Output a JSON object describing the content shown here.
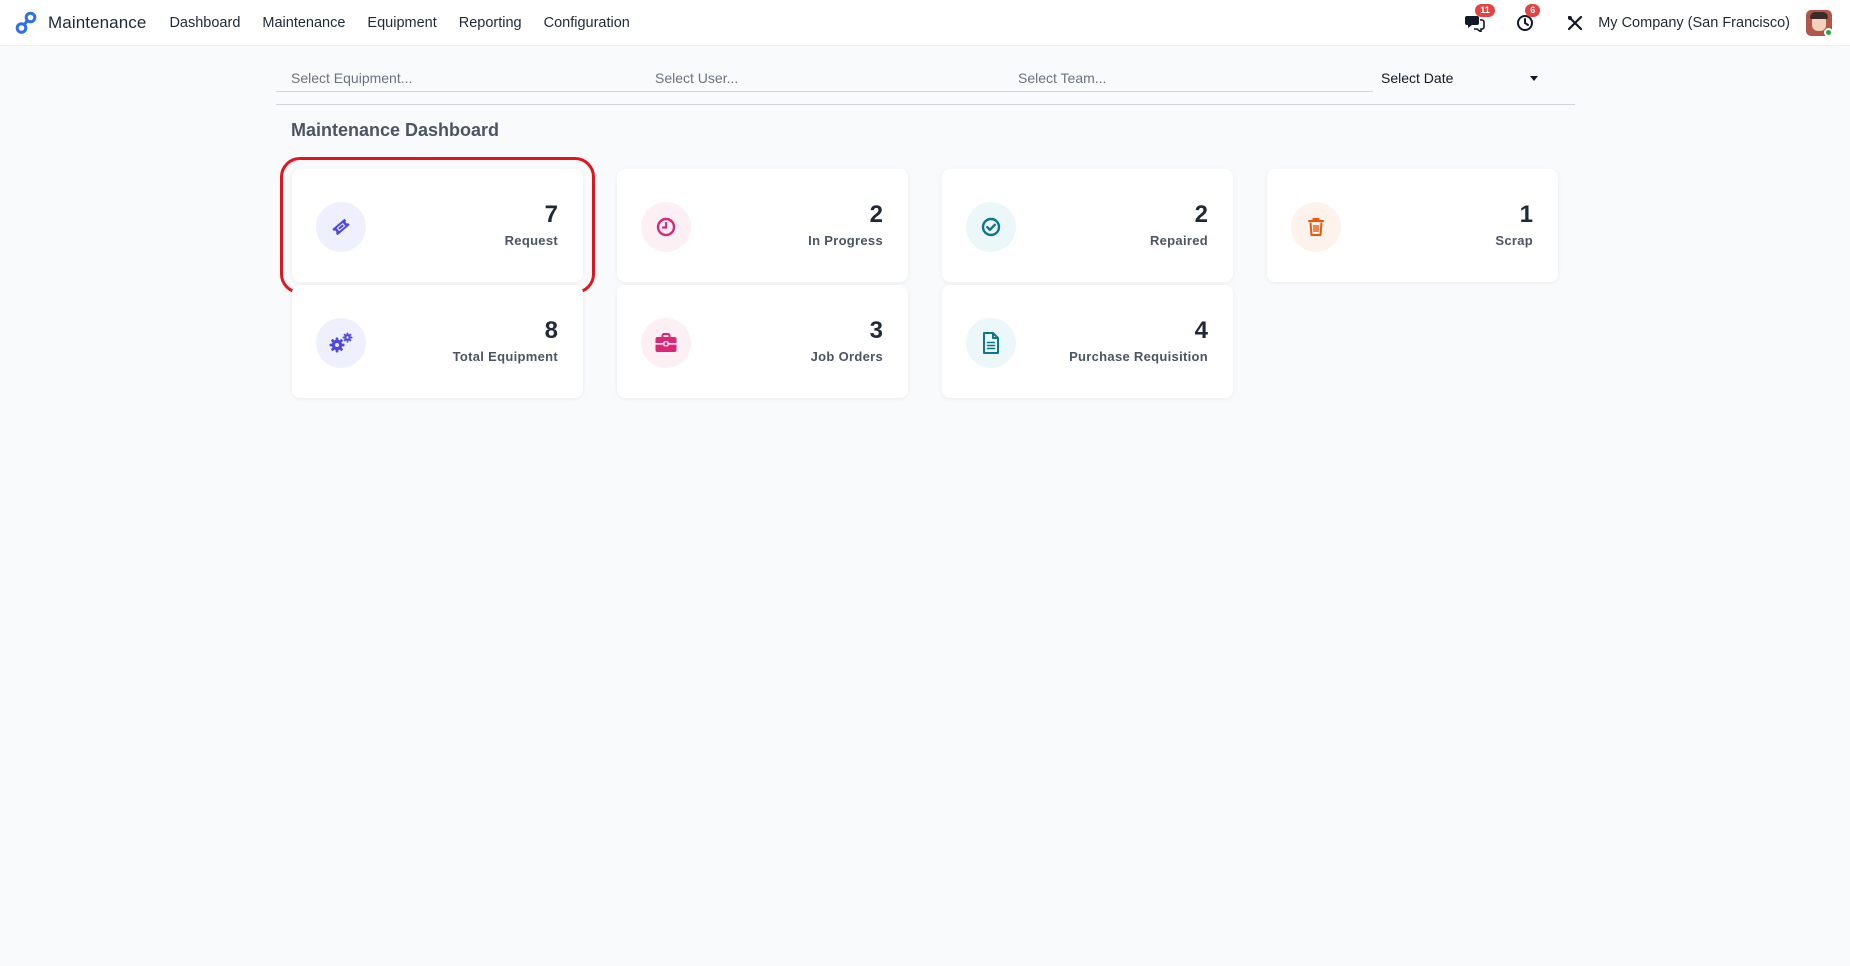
{
  "app": {
    "name": "Maintenance",
    "brand_color": "#2f6fed"
  },
  "menu": [
    {
      "label": "Dashboard"
    },
    {
      "label": "Maintenance"
    },
    {
      "label": "Equipment"
    },
    {
      "label": "Reporting"
    },
    {
      "label": "Configuration"
    }
  ],
  "systray": {
    "messages_count": "11",
    "activities_count": "6",
    "company": "My Company (San Francisco)"
  },
  "filters": {
    "equipment_placeholder": "Select Equipment...",
    "user_placeholder": "Select User...",
    "team_placeholder": "Select Team...",
    "date_label": "Select Date"
  },
  "dashboard": {
    "title": "Maintenance Dashboard",
    "cards": [
      {
        "value": "7",
        "label": "Request",
        "icon": "ticket-icon",
        "color": "#4f46e5",
        "bg": "#eef0fd",
        "selected": true
      },
      {
        "value": "2",
        "label": "In Progress",
        "icon": "clock-icon",
        "color": "#db2777",
        "bg": "#fdf0f5"
      },
      {
        "value": "2",
        "label": "Repaired",
        "icon": "check-circle-icon",
        "color": "#0e7490",
        "bg": "#ecf7f9"
      },
      {
        "value": "1",
        "label": "Scrap",
        "icon": "trash-icon",
        "color": "#ea580c",
        "bg": "#fef3ec"
      },
      {
        "value": "8",
        "label": "Total Equipment",
        "icon": "gears-icon",
        "color": "#4f46e5",
        "bg": "#eef0fd"
      },
      {
        "value": "3",
        "label": "Job Orders",
        "icon": "briefcase-icon",
        "color": "#db2777",
        "bg": "#fdf0f5"
      },
      {
        "value": "4",
        "label": "Purchase Requisition",
        "icon": "document-icon",
        "color": "#0e7490",
        "bg": "#ecf7f9"
      }
    ]
  }
}
